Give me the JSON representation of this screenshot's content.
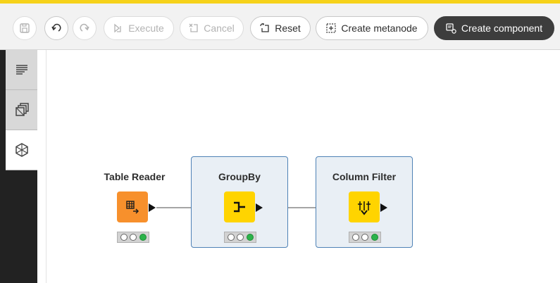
{
  "toolbar": {
    "execute_label": "Execute",
    "cancel_label": "Cancel",
    "reset_label": "Reset",
    "create_metanode_label": "Create metanode",
    "create_component_label": "Create component"
  },
  "sidebar": {
    "items": [
      {
        "name": "description-icon"
      },
      {
        "name": "node-repository-icon"
      },
      {
        "name": "workflow-monitor-icon"
      }
    ]
  },
  "workflow": {
    "nodes": [
      {
        "name": "Table Reader",
        "kind": "source",
        "color": "#f7902c",
        "status": [
          "idle",
          "idle",
          "executed"
        ]
      },
      {
        "name": "GroupBy",
        "kind": "manipulator",
        "color": "#ffd400",
        "status": [
          "idle",
          "idle",
          "executed"
        ],
        "selected": true
      },
      {
        "name": "Column Filter",
        "kind": "manipulator",
        "color": "#ffd400",
        "status": [
          "idle",
          "idle",
          "executed"
        ],
        "selected": true
      }
    ]
  },
  "colors": {
    "accent_yellow": "#f6d21a",
    "selection_border": "#4f82b6",
    "selection_fill": "#e9eff5",
    "status_green": "#2bb34a"
  }
}
